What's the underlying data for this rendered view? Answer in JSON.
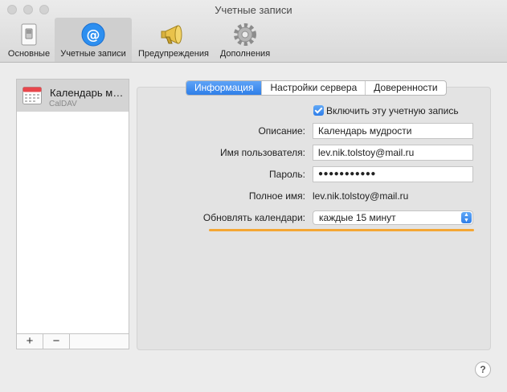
{
  "window": {
    "title": "Учетные записи"
  },
  "toolbar": {
    "items": [
      {
        "label": "Основные",
        "icon": "general-switch-icon"
      },
      {
        "label": "Учетные записи",
        "icon": "at-sign-icon",
        "active": true
      },
      {
        "label": "Предупреждения",
        "icon": "megaphone-icon"
      },
      {
        "label": "Дополнения",
        "icon": "gear-icon"
      }
    ]
  },
  "sidebar": {
    "accounts": [
      {
        "name": "Календарь мудрости",
        "type": "CalDAV",
        "icon": "calendar-icon"
      }
    ],
    "add_label": "+",
    "remove_label": "−"
  },
  "tabs": [
    {
      "label": "Информация",
      "active": true
    },
    {
      "label": "Настройки сервера"
    },
    {
      "label": "Доверенности"
    }
  ],
  "form": {
    "enable_label": "Включить эту учетную запись",
    "enable_checked": true,
    "description_label": "Описание:",
    "description_value": "Календарь мудрости",
    "username_label": "Имя пользователя:",
    "username_value": "lev.nik.tolstoy@mail.ru",
    "password_label": "Пароль:",
    "password_value": "●●●●●●●●●●●",
    "fullname_label": "Полное имя:",
    "fullname_value": "lev.nik.tolstoy@mail.ru",
    "refresh_label": "Обновлять календари:",
    "refresh_value": "каждые 15 минут"
  },
  "help_label": "?",
  "colors": {
    "accent": "#2f7ee9",
    "highlight": "#f4a634"
  }
}
